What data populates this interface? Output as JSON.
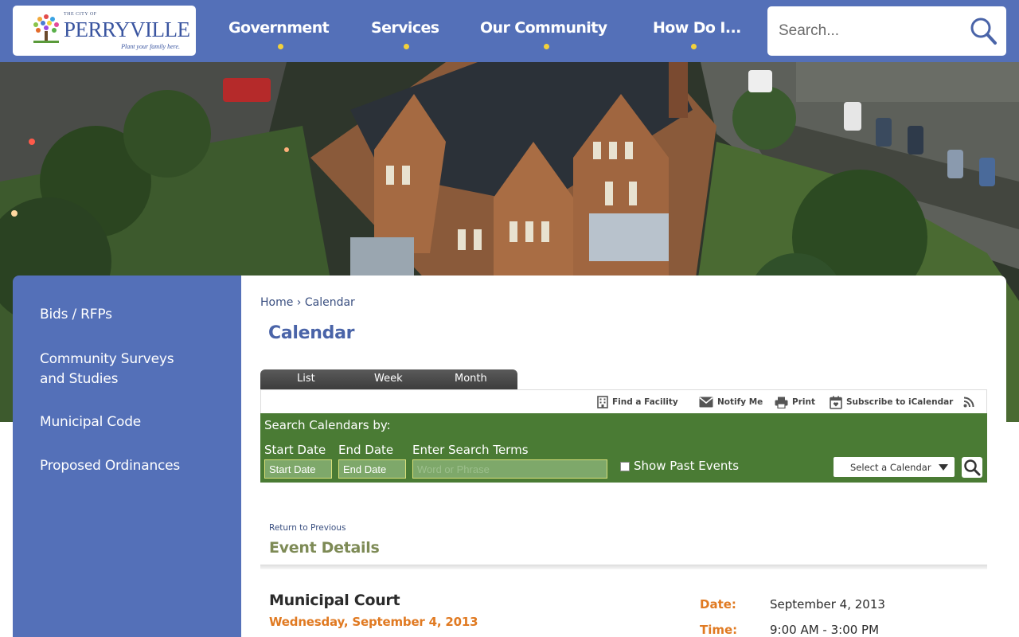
{
  "colors": {
    "header_bg": "#5470b8",
    "accent_yellow": "#f2d13b",
    "search_panel_green": "#4a7b34",
    "title_blue": "#4a64a8",
    "date_orange": "#e07a22",
    "section_olive": "#7d8a55"
  },
  "logo": {
    "small_text": "THE CITY OF",
    "name": "PERRYVILLE",
    "tagline": "Plant your family here."
  },
  "nav": {
    "items": [
      {
        "label": "Government"
      },
      {
        "label": "Services"
      },
      {
        "label": "Our Community"
      },
      {
        "label": "How Do I..."
      }
    ]
  },
  "search": {
    "placeholder": "Search...",
    "icon": "search-icon"
  },
  "sidebar": {
    "items": [
      {
        "label": "Bids / RFPs"
      },
      {
        "label": "Community Surveys and Studies"
      },
      {
        "label": "Municipal Code"
      },
      {
        "label": "Proposed Ordinances"
      }
    ]
  },
  "breadcrumb": {
    "home": "Home",
    "separator": "›",
    "current": "Calendar"
  },
  "page_title": "Calendar",
  "tabs": [
    {
      "label": "List"
    },
    {
      "label": "Week"
    },
    {
      "label": "Month"
    }
  ],
  "toolbar": {
    "find_facility": "Find a Facility",
    "notify_me": "Notify Me",
    "print": "Print",
    "subscribe": "Subscribe to iCalendar"
  },
  "search_panel": {
    "title": "Search Calendars by:",
    "start_label": "Start Date",
    "end_label": "End Date",
    "terms_label": "Enter Search Terms",
    "start_placeholder": "Start Date",
    "end_placeholder": "End Date",
    "terms_placeholder": "Word or Phrase",
    "show_past": "Show Past Events",
    "select_calendar": "Select a Calendar"
  },
  "event": {
    "return_link": "Return to Previous",
    "section_title": "Event Details",
    "title": "Municipal Court",
    "date_full": "Wednesday, September 4, 2013",
    "date_label": "Date:",
    "date_value": "September 4, 2013",
    "time_label": "Time:",
    "time_value": "9:00 AM - 3:00 PM"
  }
}
